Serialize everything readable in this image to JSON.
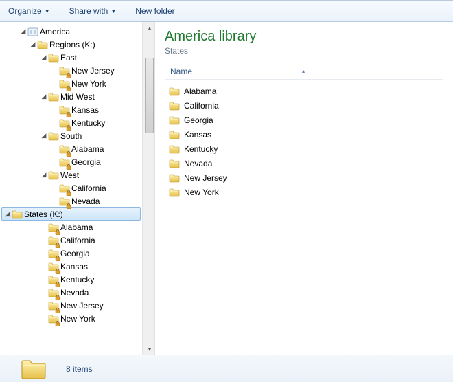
{
  "toolbar": {
    "organize": "Organize",
    "share": "Share with",
    "newfolder": "New folder"
  },
  "tree": {
    "root": "America",
    "regions": "Regions (K:)",
    "east": "East",
    "east_items": [
      "New Jersey",
      "New York"
    ],
    "midwest": "Mid West",
    "midwest_items": [
      "Kansas",
      "Kentucky"
    ],
    "south": "South",
    "south_items": [
      "Alabama",
      "Georgia"
    ],
    "west": "West",
    "west_items": [
      "California",
      "Nevada"
    ],
    "states": "States (K:)",
    "states_items": [
      "Alabama",
      "California",
      "Georgia",
      "Kansas",
      "Kentucky",
      "Nevada",
      "New Jersey",
      "New York"
    ]
  },
  "content": {
    "title": "America library",
    "subtitle": "States",
    "col_name": "Name",
    "items": [
      "Alabama",
      "California",
      "Georgia",
      "Kansas",
      "Kentucky",
      "Nevada",
      "New Jersey",
      "New York"
    ]
  },
  "status": {
    "count": "8 items"
  }
}
